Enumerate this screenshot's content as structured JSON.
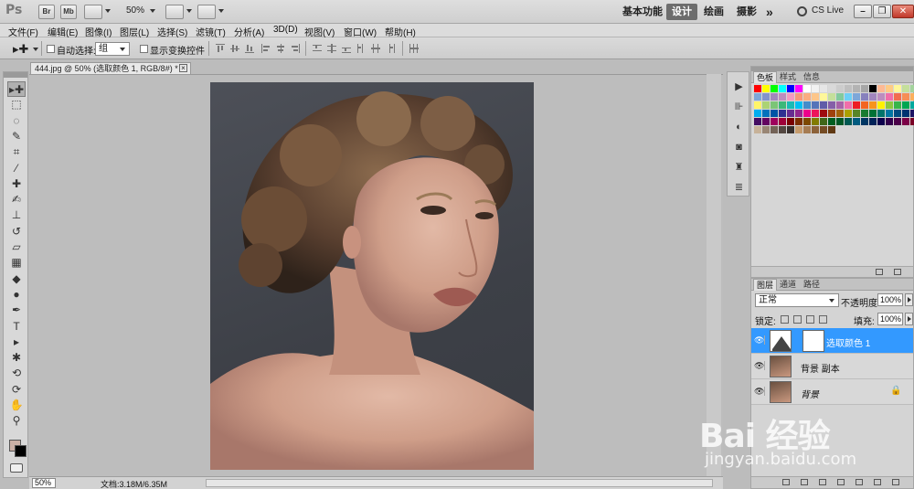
{
  "app": {
    "logo": "Ps",
    "bridge_label": "Br",
    "minibridge_label": "Mb",
    "zoom": "50%",
    "workspaces": [
      "基本功能",
      "设计",
      "绘画",
      "摄影"
    ],
    "active_workspace": "设计",
    "more_label": "»",
    "cslive": "CS Live"
  },
  "menu": {
    "items": [
      "文件(F)",
      "编辑(E)",
      "图像(I)",
      "图层(L)",
      "选择(S)",
      "滤镜(T)",
      "分析(A)",
      "3D(D)",
      "视图(V)",
      "窗口(W)",
      "帮助(H)"
    ]
  },
  "options": {
    "auto_select_label": "自动选择:",
    "auto_select_value": "组",
    "show_transform_label": "显示变换控件"
  },
  "document": {
    "tab_title": "444.jpg @ 50% (选取颜色 1, RGB/8#) *",
    "close_label": "×",
    "zoom_field": "50%",
    "doc_info": "文档:3.18M/6.35M"
  },
  "tools": [
    {
      "name": "move-tool",
      "glyph": "▸✚"
    },
    {
      "name": "marquee-tool",
      "glyph": "⬚"
    },
    {
      "name": "lasso-tool",
      "glyph": "◌"
    },
    {
      "name": "quick-select-tool",
      "glyph": "✎"
    },
    {
      "name": "crop-tool",
      "glyph": "⌗"
    },
    {
      "name": "eyedropper-tool",
      "glyph": "⁄"
    },
    {
      "name": "healing-brush-tool",
      "glyph": "✚"
    },
    {
      "name": "brush-tool",
      "glyph": "✍"
    },
    {
      "name": "clone-stamp-tool",
      "glyph": "⊥"
    },
    {
      "name": "history-brush-tool",
      "glyph": "↺"
    },
    {
      "name": "eraser-tool",
      "glyph": "▱"
    },
    {
      "name": "gradient-tool",
      "glyph": "▦"
    },
    {
      "name": "blur-tool",
      "glyph": "◆"
    },
    {
      "name": "dodge-tool",
      "glyph": "●"
    },
    {
      "name": "pen-tool",
      "glyph": "✒"
    },
    {
      "name": "type-tool",
      "glyph": "T"
    },
    {
      "name": "path-select-tool",
      "glyph": "▸"
    },
    {
      "name": "shape-tool",
      "glyph": "✱"
    },
    {
      "name": "3d-rotate-tool",
      "glyph": "⟲"
    },
    {
      "name": "3d-orbit-tool",
      "glyph": "⟳"
    },
    {
      "name": "hand-tool",
      "glyph": "✋"
    },
    {
      "name": "zoom-tool",
      "glyph": "⚲"
    }
  ],
  "swatches_panel": {
    "tabs": [
      "色板",
      "样式",
      "信息"
    ],
    "active_tab": "色板",
    "colors": [
      "#ff0000",
      "#ffff00",
      "#00ff00",
      "#00ffff",
      "#0000ff",
      "#ff00ff",
      "#ffffff",
      "#f2f2f2",
      "#e6e6e6",
      "#d9d9d9",
      "#cccccc",
      "#bfbfbf",
      "#b3b3b3",
      "#a6a6a6",
      "#000000",
      "#fdb994",
      "#fecb85",
      "#fff79a",
      "#c4df9b",
      "#a3d39c",
      "#7ea7d8",
      "#8393ca",
      "#a286bd",
      "#bd8cbf",
      "#f49ac1",
      "#f7977a",
      "#f9ad81",
      "#fdc68a",
      "#fff79a",
      "#c4df9b",
      "#82ca9d",
      "#6dcff6",
      "#7da7d9",
      "#8781bd",
      "#a186be",
      "#bc8dbf",
      "#f06eaa",
      "#f26c4f",
      "#f68e56",
      "#fbaf5d",
      "#fff568",
      "#acd373",
      "#7cc576",
      "#3bb878",
      "#1abbb4",
      "#00bff3",
      "#438ccb",
      "#5574b9",
      "#605ca8",
      "#855fa8",
      "#a763a8",
      "#f06eaa",
      "#ed1c24",
      "#f26522",
      "#f7941d",
      "#fff200",
      "#8dc73f",
      "#39b54a",
      "#00a651",
      "#00a99d",
      "#00aeef",
      "#0072bc",
      "#0054a6",
      "#2e3192",
      "#662d91",
      "#92278f",
      "#ec008c",
      "#ed145b",
      "#9e0b0f",
      "#a0410d",
      "#a3620a",
      "#aba000",
      "#598527",
      "#197b30",
      "#007236",
      "#00746b",
      "#0076a3",
      "#004b80",
      "#003471",
      "#1b1464",
      "#440e62",
      "#630460",
      "#9e005d",
      "#9e0039",
      "#790000",
      "#7b2e00",
      "#7d4900",
      "#827b00",
      "#406618",
      "#005e20",
      "#005826",
      "#005952",
      "#005b7f",
      "#003663",
      "#002157",
      "#0d004c",
      "#32004b",
      "#4b0049",
      "#7b0046",
      "#7a0026",
      "#c7b299",
      "#998675",
      "#736357",
      "#534741",
      "#37302d",
      "#c69c6d",
      "#a67c52",
      "#8c6239",
      "#754c24",
      "#603913"
    ]
  },
  "layers_panel": {
    "tabs": [
      "图层",
      "通道",
      "路径"
    ],
    "active_tab": "图层",
    "blend_mode": "正常",
    "opacity_label": "不透明度:",
    "opacity_value": "100%",
    "lock_label": "锁定:",
    "fill_label": "填充:",
    "fill_value": "100%",
    "layers": [
      {
        "name": "选取颜色 1",
        "kind": "adjustment",
        "selected": true
      },
      {
        "name": "背景 副本",
        "kind": "photo",
        "selected": false
      },
      {
        "name": "背景",
        "kind": "photo",
        "selected": false,
        "locked": true
      }
    ]
  },
  "watermark": {
    "logo": "Bai 经验",
    "url": "jingyan.baidu.com"
  }
}
